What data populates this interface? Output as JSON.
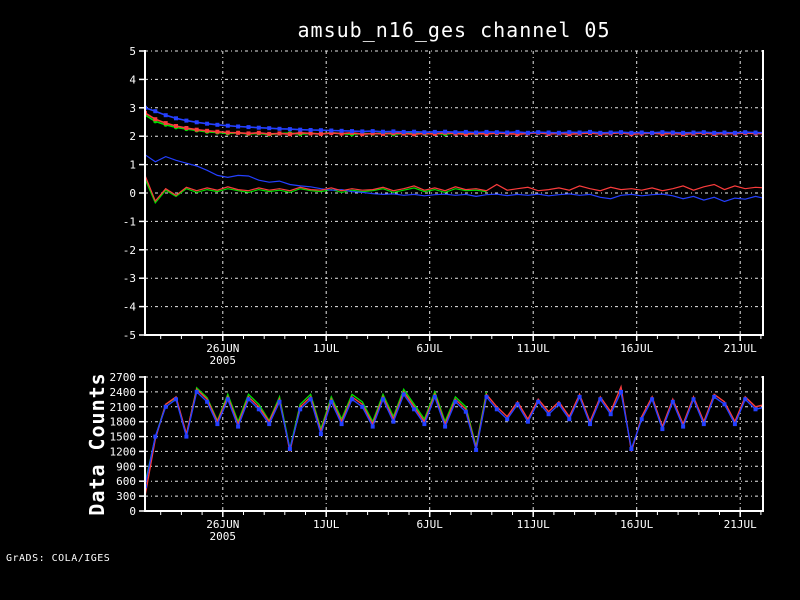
{
  "title": "amsub_n16_ges channel 05",
  "footer": "GrADS: COLA/IGES",
  "colors": {
    "background": "#000000",
    "frame": "#ffffff",
    "text": "#ffffff",
    "grid": "#e8e8e8",
    "red": "#fa3c3c",
    "green": "#00dc00",
    "blue": "#2440ff"
  },
  "chart_data": [
    {
      "id": "top",
      "type": "line",
      "title": "amsub_n16_ges channel 05",
      "xlabel": "",
      "ylabel": "",
      "ylim": [
        -5,
        5
      ],
      "ytick_step": 1,
      "grid": "dot-dash",
      "legend": "none",
      "x_axis": {
        "end_day": 29.86,
        "minor_tick_start": 0.757,
        "minor_tick_step": 1,
        "major_ticks": [
          {
            "day": 3.757,
            "label": "26JUN",
            "sublabel": "2005"
          },
          {
            "day": 8.757,
            "label": "1JUL"
          },
          {
            "day": 13.757,
            "label": "6JUL"
          },
          {
            "day": 18.757,
            "label": "11JUL"
          },
          {
            "day": 23.757,
            "label": "16JUL"
          },
          {
            "day": 28.757,
            "label": "21JUL"
          }
        ]
      },
      "series": [
        {
          "id": "upper-green",
          "color": "green",
          "marker": "dot",
          "width": 1.6,
          "dt": 0.5,
          "values": [
            2.75,
            2.52,
            2.4,
            2.31,
            2.25,
            2.2,
            2.15,
            2.13,
            2.1,
            2.12,
            2.08,
            2.1,
            2.06,
            2.09,
            2.11,
            2.07,
            2.1,
            2.08,
            2.12,
            2.09,
            2.06,
            2.1,
            2.08,
            2.11,
            2.07,
            2.09,
            2.12,
            2.08,
            2.1,
            2.07,
            2.11,
            2.09,
            2.08,
            2.1
          ]
        },
        {
          "id": "upper-red",
          "color": "red",
          "marker": "square",
          "width": 1.6,
          "dt": 0.5,
          "values": [
            2.82,
            2.6,
            2.46,
            2.36,
            2.29,
            2.23,
            2.19,
            2.16,
            2.13,
            2.12,
            2.1,
            2.12,
            2.08,
            2.1,
            2.07,
            2.12,
            2.1,
            2.08,
            2.11,
            2.09,
            2.12,
            2.07,
            2.1,
            2.08,
            2.11,
            2.09,
            2.07,
            2.1,
            2.08,
            2.12,
            2.09,
            2.07,
            2.1,
            2.08,
            2.11,
            2.09,
            2.07,
            2.1,
            2.12,
            2.08,
            2.1,
            2.07,
            2.09,
            2.11,
            2.08,
            2.1,
            2.12,
            2.07,
            2.09,
            2.11,
            2.08,
            2.1,
            2.07,
            2.09,
            2.11,
            2.08,
            2.1,
            2.09,
            2.11,
            2.1,
            2.09
          ]
        },
        {
          "id": "upper-blue",
          "color": "blue",
          "marker": "square",
          "width": 1.6,
          "dt": 0.5,
          "values": [
            3.0,
            2.88,
            2.74,
            2.63,
            2.55,
            2.49,
            2.44,
            2.4,
            2.37,
            2.34,
            2.32,
            2.3,
            2.28,
            2.26,
            2.25,
            2.23,
            2.22,
            2.21,
            2.2,
            2.19,
            2.18,
            2.17,
            2.18,
            2.16,
            2.17,
            2.15,
            2.16,
            2.14,
            2.15,
            2.16,
            2.14,
            2.15,
            2.13,
            2.15,
            2.14,
            2.13,
            2.15,
            2.12,
            2.14,
            2.13,
            2.12,
            2.14,
            2.13,
            2.15,
            2.12,
            2.13,
            2.14,
            2.12,
            2.13,
            2.12,
            2.14,
            2.13,
            2.12,
            2.13,
            2.14,
            2.12,
            2.13,
            2.12,
            2.14,
            2.13,
            2.12
          ]
        },
        {
          "id": "lower-green",
          "color": "green",
          "marker": "none",
          "width": 1.2,
          "dt": 0.5,
          "values": [
            0.5,
            -0.35,
            0.1,
            -0.12,
            0.15,
            0.02,
            0.12,
            0.05,
            0.15,
            0.08,
            0.02,
            0.12,
            0.05,
            0.1,
            0.02,
            0.15,
            0.08,
            0.05,
            0.12,
            0.02,
            0.1,
            0.05,
            0.08,
            0.15,
            0.02,
            0.1,
            0.18,
            0.05,
            0.12,
            0.02,
            0.15,
            0.08,
            0.1,
            0.05
          ]
        },
        {
          "id": "lower-blue",
          "color": "blue",
          "marker": "none",
          "width": 1.2,
          "dt": 0.5,
          "values": [
            1.35,
            1.1,
            1.28,
            1.15,
            1.05,
            0.95,
            0.8,
            0.62,
            0.55,
            0.62,
            0.6,
            0.45,
            0.38,
            0.42,
            0.3,
            0.25,
            0.22,
            0.15,
            0.1,
            0.12,
            0.05,
            0.02,
            -0.02,
            -0.05,
            -0.03,
            -0.08,
            -0.05,
            -0.1,
            -0.06,
            -0.04,
            -0.08,
            -0.05,
            -0.12,
            -0.06,
            -0.04,
            -0.09,
            -0.05,
            -0.08,
            -0.04,
            -0.1,
            -0.06,
            -0.03,
            -0.08,
            -0.05,
            -0.15,
            -0.2,
            -0.08,
            -0.05,
            -0.1,
            -0.06,
            -0.04,
            -0.1,
            -0.2,
            -0.12,
            -0.25,
            -0.15,
            -0.3,
            -0.18,
            -0.22,
            -0.12,
            -0.2
          ]
        },
        {
          "id": "lower-red",
          "color": "red",
          "marker": "none",
          "width": 1.2,
          "dt": 0.5,
          "values": [
            0.62,
            -0.28,
            0.15,
            -0.08,
            0.2,
            0.08,
            0.18,
            0.1,
            0.22,
            0.12,
            0.08,
            0.18,
            0.1,
            0.15,
            0.08,
            0.2,
            0.12,
            0.1,
            0.18,
            0.08,
            0.15,
            0.1,
            0.12,
            0.2,
            0.08,
            0.15,
            0.25,
            0.1,
            0.18,
            0.08,
            0.22,
            0.12,
            0.15,
            0.08,
            0.3,
            0.1,
            0.15,
            0.2,
            0.08,
            0.12,
            0.18,
            0.1,
            0.25,
            0.15,
            0.08,
            0.2,
            0.12,
            0.15,
            0.1,
            0.18,
            0.08,
            0.15,
            0.25,
            0.1,
            0.22,
            0.3,
            0.12,
            0.25,
            0.15,
            0.2,
            0.18
          ]
        }
      ]
    },
    {
      "id": "bottom",
      "type": "line",
      "title": "",
      "xlabel": "",
      "ylabel": "Data Counts",
      "ylim": [
        0,
        2700
      ],
      "ytick_step": 300,
      "grid": "dot-dash",
      "legend": "none",
      "x_axis": {
        "end_day": 29.86,
        "minor_tick_start": 0.757,
        "minor_tick_step": 1,
        "major_ticks": [
          {
            "day": 3.757,
            "label": "26JUN",
            "sublabel": "2005"
          },
          {
            "day": 8.757,
            "label": "1JUL"
          },
          {
            "day": 13.757,
            "label": "6JUL"
          },
          {
            "day": 18.757,
            "label": "11JUL"
          },
          {
            "day": 23.757,
            "label": "16JUL"
          },
          {
            "day": 28.757,
            "label": "21JUL"
          }
        ]
      },
      "series": [
        {
          "id": "counts-green",
          "color": "green",
          "marker": "none",
          "width": 1.4,
          "dt": 0.5,
          "values": [
            550,
            1480,
            2150,
            2280,
            1520,
            2480,
            2280,
            1820,
            2350,
            1800,
            2350,
            2150,
            1820,
            2300,
            1250,
            2150,
            2350,
            1650,
            2300,
            1850,
            2350,
            2200,
            1800,
            2350,
            1900,
            2450,
            2150,
            1850,
            2400,
            1800,
            2300,
            2100,
            1300,
            2400
          ]
        },
        {
          "id": "counts-red",
          "color": "red",
          "marker": "none",
          "width": 1.4,
          "dt": 0.5,
          "values": [
            300,
            1450,
            2150,
            2300,
            1550,
            2450,
            2250,
            1800,
            2300,
            1750,
            2300,
            2100,
            1800,
            2250,
            1200,
            2100,
            2300,
            1600,
            2250,
            1800,
            2300,
            2150,
            1750,
            2300,
            1850,
            2400,
            2100,
            1800,
            2350,
            1750,
            2250,
            2050,
            1270,
            2350,
            2100,
            1900,
            2200,
            1850,
            2250,
            2000,
            2200,
            1900,
            2350,
            1800,
            2300,
            2000,
            2500,
            1200,
            1900,
            2300,
            1700,
            2250,
            1750,
            2300,
            1800,
            2350,
            2200,
            1800,
            2300,
            2100,
            2150
          ]
        },
        {
          "id": "counts-blue",
          "color": "blue",
          "marker": "square",
          "width": 1.4,
          "dt": 0.5,
          "values": [
            500,
            1500,
            2100,
            2250,
            1500,
            2400,
            2200,
            1750,
            2250,
            1700,
            2250,
            2050,
            1750,
            2200,
            1250,
            2050,
            2250,
            1550,
            2200,
            1750,
            2250,
            2100,
            1700,
            2250,
            1800,
            2350,
            2050,
            1750,
            2300,
            1700,
            2200,
            2000,
            1230,
            2300,
            2050,
            1850,
            2150,
            1800,
            2200,
            1950,
            2150,
            1850,
            2300,
            1750,
            2250,
            1950,
            2400,
            1250,
            1850,
            2250,
            1650,
            2200,
            1700,
            2250,
            1750,
            2300,
            2150,
            1750,
            2250,
            2050,
            2100
          ]
        }
      ]
    }
  ]
}
